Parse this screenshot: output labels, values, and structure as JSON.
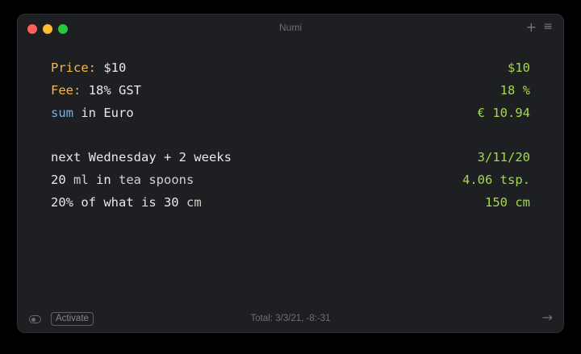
{
  "window": {
    "title": "Numi",
    "plus_icon": "+",
    "menu_icon": "≡"
  },
  "lines": [
    {
      "label": "Price:",
      "text": " $10",
      "result": "$10"
    },
    {
      "label": "Fee:",
      "text": " 18% GST",
      "result": "18 %"
    },
    {
      "keyword": "sum",
      "text": " in Euro",
      "result": "€ 10.94"
    },
    {
      "text": "next Wednesday + 2 weeks",
      "result": "3/11/20"
    },
    {
      "text_a": "20 ",
      "unit_a": "ml",
      "text_b": " in ",
      "unit_b": "tea spoons",
      "result": "4.06 tsp."
    },
    {
      "text_a": "20% of what is 30 ",
      "unit_a": "cm",
      "result": "150 cm"
    }
  ],
  "footer": {
    "activate_label": "Activate",
    "total": "Total: 3/3/21, -8:-31",
    "arrow_icon": "→"
  },
  "colors": {
    "window_bg": "#1e1f22",
    "label": "#f5b94a",
    "keyword": "#6fb3e8",
    "result": "#a3d84c",
    "text": "#e8e8e8"
  },
  "icons": [
    "close-button",
    "minimize-button",
    "zoom-button",
    "plus-icon",
    "menu-icon",
    "toggle-icon",
    "arrow-right-icon"
  ]
}
